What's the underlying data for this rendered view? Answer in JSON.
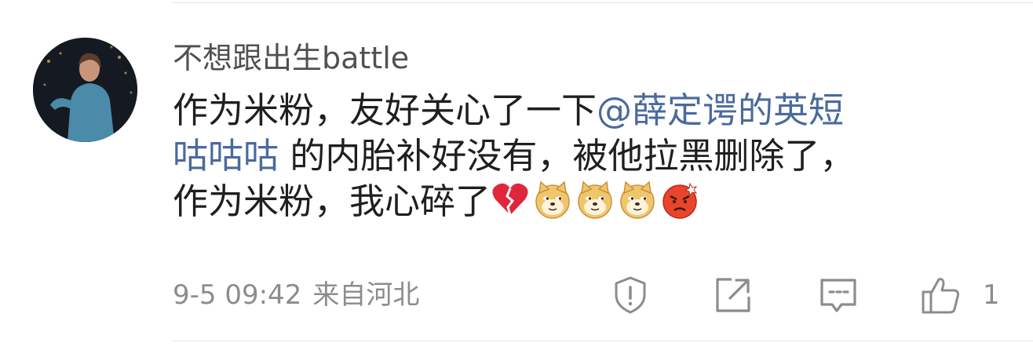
{
  "comment": {
    "username": "不想跟出生battle",
    "content": {
      "line1_text": "作为米粉，友好关心了一下",
      "line1_mention": "@薛定谔的英短",
      "line2_mention": "咕咕咕",
      "line2_text": " 的内胎补好没有，被他拉黑删除了，",
      "line3_text": "作为米粉，我心碎了"
    },
    "emojis": [
      "broken-heart",
      "doge",
      "doge",
      "doge",
      "angry"
    ],
    "time": "9-5 09:42",
    "location": "来自河北",
    "like_count": "1"
  },
  "colors": {
    "mention": "#4a6a9c",
    "meta": "#8c8c8c",
    "username": "#505050"
  }
}
